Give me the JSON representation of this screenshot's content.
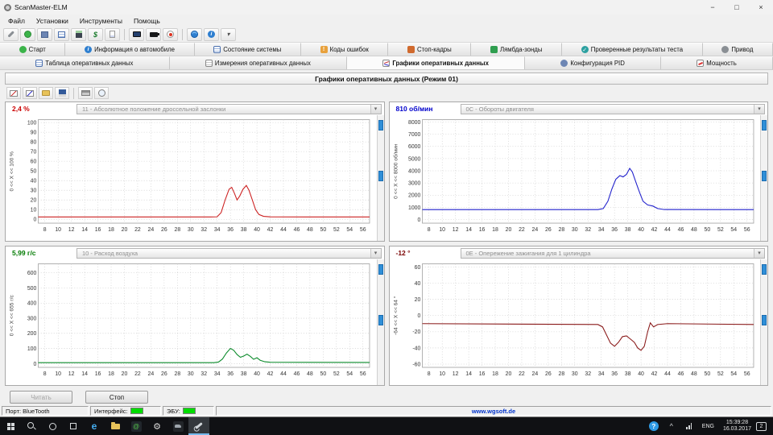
{
  "window": {
    "title": "ScanMaster-ELM",
    "minimize_glyph": "−",
    "maximize_glyph": "□",
    "close_glyph": "×"
  },
  "menu": [
    "Файл",
    "Установки",
    "Инструменты",
    "Помощь"
  ],
  "tabs_row1": [
    "Старт",
    "Информация о автомобиле",
    "Состояние системы",
    "Коды ошибок",
    "Стоп-кадры",
    "Лямбда-зонды",
    "Проверенные результаты теста",
    "Привод"
  ],
  "tabs_row2": [
    "Таблица оперативных данных",
    "Измерения оперативных данных",
    "Графики оперативных данных",
    "Конфигурация PID",
    "Мощность"
  ],
  "section_title": "Графики оперативных данных (Режим 01)",
  "charts": [
    {
      "type": "line",
      "value": "2,4 %",
      "value_color": "#cc0000",
      "pid_label": "11 - Абсолютное положение дроссельной заслонки",
      "axis_label": "0 << X << 100 %",
      "line_color": "#cc2020",
      "xmin": 7,
      "xmax": 57,
      "ymin": -4,
      "ymax": 103,
      "x_ticks": [
        8,
        10,
        12,
        14,
        16,
        18,
        20,
        22,
        24,
        26,
        28,
        30,
        32,
        34,
        36,
        38,
        40,
        42,
        44,
        46,
        48,
        50,
        52,
        54,
        56
      ],
      "y_ticks": [
        0,
        10,
        20,
        30,
        40,
        50,
        60,
        70,
        80,
        90,
        100
      ],
      "points": [
        [
          7,
          2.4
        ],
        [
          33,
          2.4
        ],
        [
          34,
          2.6
        ],
        [
          34.6,
          7
        ],
        [
          35.2,
          20
        ],
        [
          35.8,
          31
        ],
        [
          36.2,
          33
        ],
        [
          36.6,
          27
        ],
        [
          37,
          20
        ],
        [
          37.4,
          24
        ],
        [
          37.9,
          31
        ],
        [
          38.4,
          35
        ],
        [
          38.8,
          30
        ],
        [
          39.3,
          20
        ],
        [
          39.8,
          10
        ],
        [
          40.3,
          5
        ],
        [
          41,
          3
        ],
        [
          42,
          2.5
        ],
        [
          57,
          2.4
        ]
      ]
    },
    {
      "type": "line",
      "value": "810 об/мин",
      "value_color": "#0000cc",
      "pid_label": "0C - Обороты двигателя",
      "axis_label": "0 << X << 8000 об/мин",
      "line_color": "#2020cc",
      "xmin": 7,
      "xmax": 57,
      "ymin": -300,
      "ymax": 8200,
      "x_ticks": [
        8,
        10,
        12,
        14,
        16,
        18,
        20,
        22,
        24,
        26,
        28,
        30,
        32,
        34,
        36,
        38,
        40,
        42,
        44,
        46,
        48,
        50,
        52,
        54,
        56
      ],
      "y_ticks": [
        0,
        1000,
        2000,
        3000,
        4000,
        5000,
        6000,
        7000,
        8000
      ],
      "points": [
        [
          7,
          810
        ],
        [
          33.5,
          810
        ],
        [
          34.3,
          900
        ],
        [
          35,
          1500
        ],
        [
          35.6,
          2500
        ],
        [
          36.2,
          3300
        ],
        [
          36.8,
          3600
        ],
        [
          37.3,
          3500
        ],
        [
          37.8,
          3700
        ],
        [
          38.3,
          4200
        ],
        [
          38.7,
          3900
        ],
        [
          39.2,
          3100
        ],
        [
          39.8,
          2200
        ],
        [
          40.3,
          1500
        ],
        [
          41,
          1200
        ],
        [
          41.8,
          1100
        ],
        [
          42.5,
          900
        ],
        [
          43.5,
          820
        ],
        [
          57,
          810
        ]
      ]
    },
    {
      "type": "line",
      "value": "5,99 г/с",
      "value_color": "#007a00",
      "pid_label": "10 - Расход воздуха",
      "axis_label": "0 << X << 655 г/с",
      "line_color": "#0a8a2a",
      "xmin": 7,
      "xmax": 57,
      "ymin": -25,
      "ymax": 660,
      "x_ticks": [
        8,
        10,
        12,
        14,
        16,
        18,
        20,
        22,
        24,
        26,
        28,
        30,
        32,
        34,
        36,
        38,
        40,
        42,
        44,
        46,
        48,
        50,
        52,
        54,
        56
      ],
      "y_ticks": [
        0,
        100,
        200,
        300,
        400,
        500,
        600
      ],
      "points": [
        [
          7,
          6
        ],
        [
          33.5,
          6
        ],
        [
          34.2,
          10
        ],
        [
          34.8,
          30
        ],
        [
          35.4,
          70
        ],
        [
          36,
          100
        ],
        [
          36.5,
          88
        ],
        [
          37,
          60
        ],
        [
          37.5,
          42
        ],
        [
          38,
          50
        ],
        [
          38.5,
          62
        ],
        [
          39,
          48
        ],
        [
          39.5,
          28
        ],
        [
          40,
          38
        ],
        [
          40.5,
          22
        ],
        [
          41.2,
          12
        ],
        [
          42,
          9
        ],
        [
          57,
          7
        ]
      ]
    },
    {
      "type": "line",
      "value": "-12 °",
      "value_color": "#7a0000",
      "pid_label": "0E - Опережение зажигания для 1 цилиндра",
      "axis_label": "-64 << X << 64 °",
      "line_color": "#8a1a1a",
      "xmin": 7,
      "xmax": 57,
      "ymin": -64,
      "ymax": 64,
      "x_ticks": [
        8,
        10,
        12,
        14,
        16,
        18,
        20,
        22,
        24,
        26,
        28,
        30,
        32,
        34,
        36,
        38,
        40,
        42,
        44,
        46,
        48,
        50,
        52,
        54,
        56
      ],
      "y_ticks": [
        -60,
        -40,
        -20,
        0,
        20,
        40,
        60
      ],
      "points": [
        [
          7,
          -10
        ],
        [
          33.5,
          -11
        ],
        [
          34.2,
          -14
        ],
        [
          34.8,
          -24
        ],
        [
          35.4,
          -34
        ],
        [
          36,
          -38
        ],
        [
          36.6,
          -33
        ],
        [
          37.2,
          -26
        ],
        [
          37.8,
          -25
        ],
        [
          38.4,
          -29
        ],
        [
          39,
          -33
        ],
        [
          39.5,
          -40
        ],
        [
          40,
          -43
        ],
        [
          40.5,
          -38
        ],
        [
          41,
          -20
        ],
        [
          41.4,
          -9
        ],
        [
          41.9,
          -14
        ],
        [
          42.5,
          -11
        ],
        [
          44,
          -10
        ],
        [
          57,
          -11
        ]
      ]
    }
  ],
  "buttons": {
    "read": "Читать",
    "stop": "Стоп"
  },
  "status": {
    "port": "Порт: BlueTooth",
    "interface_label": "Интерфейс:",
    "ecu_label": "ЭБУ:",
    "website": "www.wgsoft.de",
    "led_color": "#00dd00"
  },
  "taskbar": {
    "language": "ENG",
    "time": "15:39:28",
    "date": "16.03.2017",
    "notification_count": "2",
    "edge_glyph": "e",
    "mail_glyph": "@",
    "gear_glyph": "⚙",
    "help_glyph": "?",
    "chevron_glyph": "^"
  }
}
